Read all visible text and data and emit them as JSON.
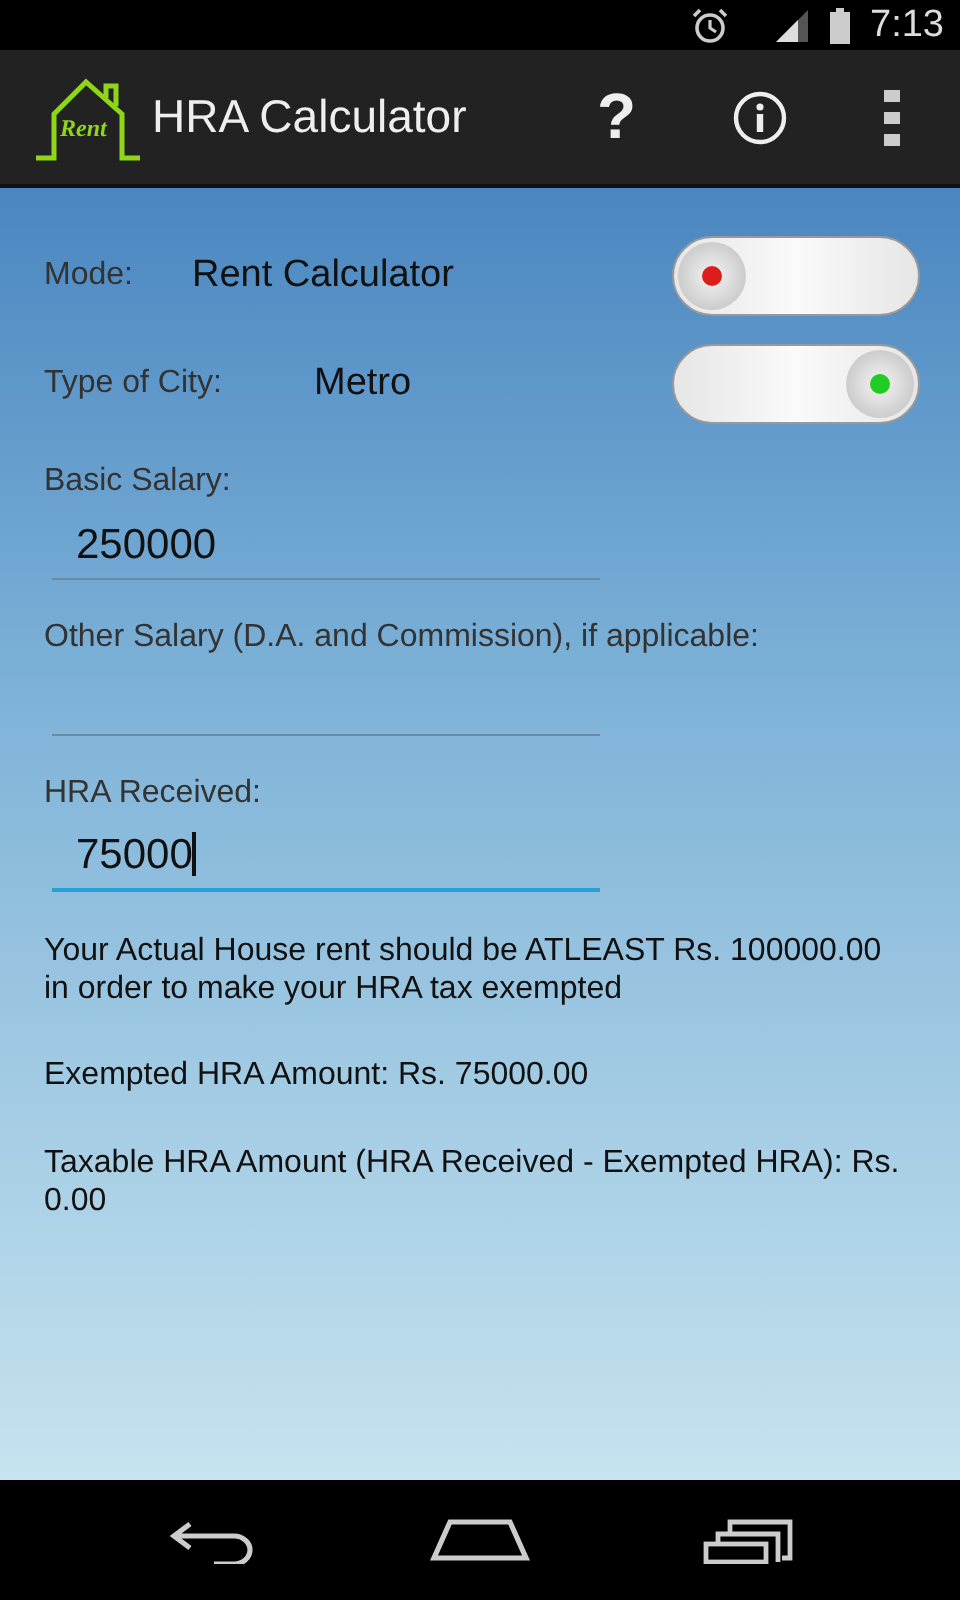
{
  "status_bar": {
    "time": "7:13"
  },
  "app_bar": {
    "title": "HRA Calculator",
    "logo_text": "Rent",
    "actions": [
      {
        "kind": "help",
        "label": "?"
      },
      {
        "kind": "info"
      },
      {
        "kind": "overflow"
      }
    ]
  },
  "toggles": [
    {
      "label": "Mode:",
      "value": "Rent Calculator",
      "on": false
    },
    {
      "label": "Type of City:",
      "value": "Metro",
      "on": true
    }
  ],
  "fields": [
    {
      "label": "Basic Salary:",
      "value": "250000",
      "focused": false
    },
    {
      "label": "Other Salary (D.A. and Commission), if applicable:",
      "focused": false
    },
    {
      "label": "HRA Received:",
      "value": "75000",
      "focused": true
    }
  ],
  "results": [
    "Your Actual House rent should be ATLEAST Rs. 100000.00 in order to make your HRA tax exempted",
    "Exempted HRA Amount: Rs. 75000.00",
    "Taxable HRA Amount (HRA Received - Exempted HRA): Rs. 0.00"
  ]
}
